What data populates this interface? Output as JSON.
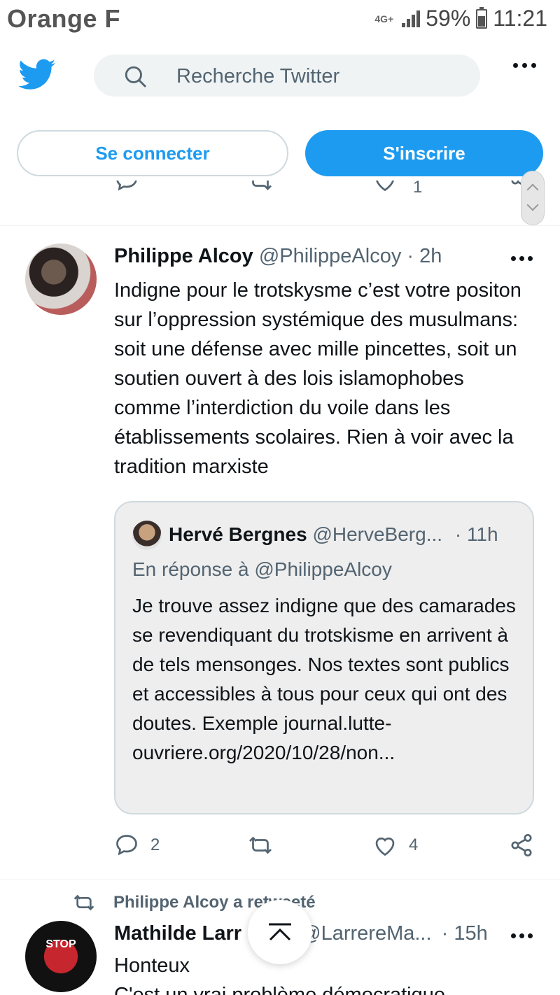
{
  "status_bar": {
    "carrier": "Orange F",
    "network": "4G+",
    "battery": "59%",
    "battery_level": 0.59,
    "time": "11:21"
  },
  "header": {
    "search_placeholder": "Recherche Twitter",
    "more_icon": "more-horizontal-icon",
    "logo_icon": "twitter-bird-icon"
  },
  "auth": {
    "login_label": "Se connecter",
    "signup_label": "S'inscrire"
  },
  "colors": {
    "brand": "#1d9bf0",
    "text_muted": "#536471",
    "border": "#cfd9de"
  },
  "previous_tweet": {
    "like_count": "1"
  },
  "tweet": {
    "name": "Philippe Alcoy",
    "handle": "@PhilippeAlcoy",
    "separator": "·",
    "time": "2h",
    "text": "Indigne pour le trotskysme c’est votre positon sur l’oppression systémique des musulmans: soit une défense avec mille pincettes, soit un soutien ouvert à des lois islamophobes comme l’interdiction du voile dans les établissements scolaires. Rien à voir avec la tradition marxiste",
    "quote": {
      "name": "Hervé Bergnes",
      "handle": "@HerveBerg...",
      "separator": "·",
      "time": "11h",
      "reply_to": "En réponse à @PhilippeAlcoy",
      "text": "Je trouve assez indigne que des camarades se revendiquant du trotskisme en arrivent à de tels mensonges. Nos textes sont publics et accessibles à tous pour ceux qui ont des doutes. Exemple journal.lutte-ouvriere.org/2020/10/28/non..."
    },
    "actions": {
      "reply_count": "2",
      "retweet_count": "",
      "like_count": "4"
    }
  },
  "next_tweet": {
    "retweet_context": "Philippe Alcoy a retweeté",
    "name": "Mathilde Larr",
    "handle": "@LarrereMa...",
    "separator": "·",
    "time": "15h",
    "text": "Honteux",
    "text_line2": "C'est un vrai problème démocratique",
    "avatar_label": "STOP"
  }
}
